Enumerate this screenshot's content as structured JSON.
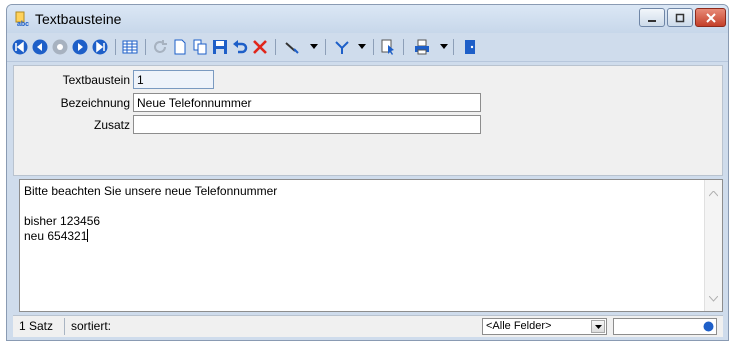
{
  "window": {
    "title": "Textbausteine"
  },
  "icons": {
    "app": "text-modules-icon",
    "first": "first-record-icon",
    "prev": "previous-record-icon",
    "current": "current-record-icon",
    "next": "next-record-icon",
    "last": "last-record-icon",
    "table": "table-view-icon",
    "refresh": "refresh-icon",
    "new": "new-record-icon",
    "copy": "copy-record-icon",
    "save": "save-icon",
    "undo": "undo-icon",
    "delete": "delete-icon",
    "tools": "tools-icon",
    "filter": "filter-icon",
    "select": "select-cursor-icon",
    "print": "print-icon",
    "exit": "exit-door-icon"
  },
  "form": {
    "textbaustein_label": "Textbaustein",
    "textbaustein_value": "1",
    "bezeichnung_label": "Bezeichnung",
    "bezeichnung_value": "Neue Telefonnummer",
    "zusatz_label": "Zusatz",
    "zusatz_value": ""
  },
  "memo": {
    "line1": "Bitte beachten Sie unsere neue Telefonnummer",
    "line2": "",
    "line3": "bisher 123456",
    "line4": "neu 654321"
  },
  "status": {
    "count": "1 Satz",
    "sort": "sortiert:",
    "field_select": "<Alle Felder>",
    "search_value": ""
  },
  "colors": {
    "accent": "#1e5fc8",
    "close": "#c4402a",
    "delete": "#e0261b"
  }
}
